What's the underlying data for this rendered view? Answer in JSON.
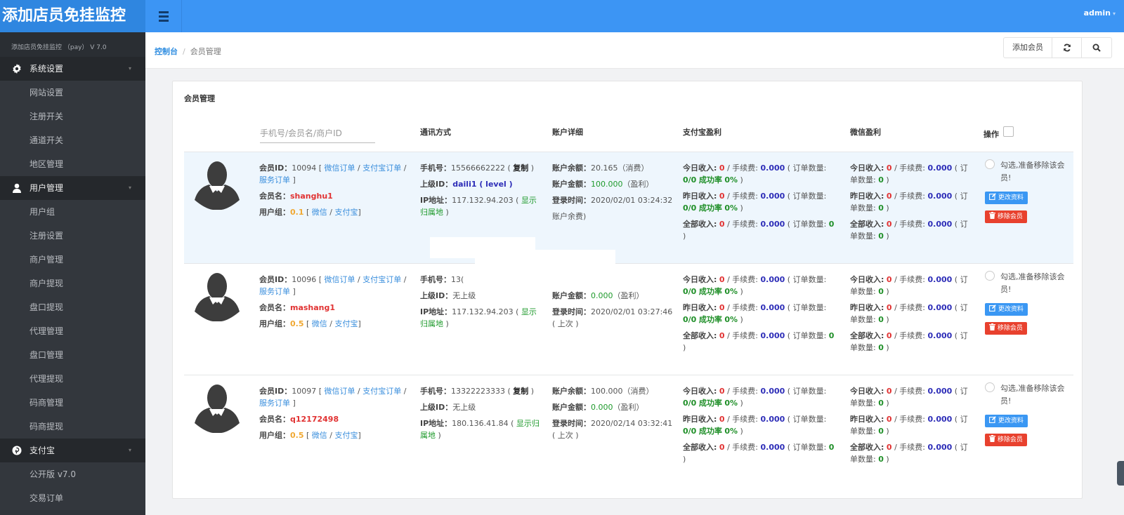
{
  "header": {
    "brand": "添加店员免挂监控",
    "menu_icon": "hamburger-icon",
    "user": "admin",
    "user_caret": "▾"
  },
  "sidebar": {
    "version": "添加店员免挂监控 （pay） V 7.0",
    "groups": [
      {
        "label": "系统设置",
        "icon": "gear-icon",
        "items": [
          "网站设置",
          "注册开关",
          "通道开关",
          "地区管理"
        ]
      },
      {
        "label": "用户管理",
        "icon": "user-icon",
        "items": [
          "用户组",
          "注册设置",
          "商户管理",
          "商户提现",
          "盘口提现",
          "代理管理",
          "盘口管理",
          "代理提现",
          "码商管理",
          "码商提现"
        ]
      },
      {
        "label": "支付宝",
        "icon": "pinterest-icon",
        "items": [
          "公开版 v7.0",
          "交易订单"
        ]
      }
    ],
    "arrow": "▾"
  },
  "breadcrumb": {
    "home": "控制台",
    "separator": "/",
    "current": "会员管理"
  },
  "toolbar": {
    "add_member": "添加会员",
    "refresh_icon": "⟳",
    "search_icon": "🔍"
  },
  "panel": {
    "title": "会员管理",
    "search_placeholder": "手机号/会员名/商户ID",
    "columns": {
      "contact": "通讯方式",
      "account": "账户详细",
      "alipay": "支付宝盈利",
      "wechat": "微信盈利",
      "ops": "操作"
    }
  },
  "labels": {
    "member_id": "会员ID：",
    "wechat_order": "微信订单",
    "alipay_order": "支付宝订单",
    "service_order": "服务订单",
    "member_name": "会员名：",
    "user_group": "用户组：",
    "wechat": "微信",
    "alipay": "支付宝",
    "phone": "手机号：",
    "copy": "复制",
    "parent_id": "上级ID：",
    "ip": "IP地址：",
    "show_location": "显示归属地",
    "balance": "账户余额：",
    "balance_note": "（消费）",
    "amount": "账户金额：",
    "amount_note": "（盈利）",
    "login_time": "登录时间：",
    "last": "( 上次 )",
    "today_income": "今日收入:",
    "yesterday_income": "昨日收入:",
    "all_income": "全部收入:",
    "fee": "/ 手续费:",
    "order_count": "( 订单数量:",
    "success_rate": "成功率",
    "remove_check": "勾选,准备移除该会员!",
    "edit_btn": "更改资料",
    "delete_btn": "移除会员"
  },
  "members": [
    {
      "id": "10094",
      "name": "shanghu1",
      "group_rate": "0.1",
      "phone": "15566662222",
      "phone_copy": true,
      "parent": "daili1 ( level )",
      "ip": "117.132.94.203",
      "balance": "20.165",
      "amount": "100.000",
      "login_time": "2020/02/01 03:24:32",
      "extra_line": "账户余费)",
      "alipay": {
        "today": {
          "income": "0",
          "fee": "0.000",
          "orders": "0/0",
          "rate": "0%"
        },
        "yesterday": {
          "income": "0",
          "fee": "0.000",
          "orders": "0/0",
          "rate": "0%"
        },
        "all": {
          "income": "0",
          "fee": "0.000",
          "orders": "0"
        }
      },
      "wechat": {
        "today": {
          "income": "0",
          "fee": "0.000",
          "orders": "0"
        },
        "yesterday": {
          "income": "0",
          "fee": "0.000",
          "orders": "0"
        },
        "all": {
          "income": "0",
          "fee": "0.000",
          "orders": "0"
        }
      }
    },
    {
      "id": "10096",
      "name": "mashang1",
      "group_rate": "0.5",
      "phone": "13(",
      "phone_copy": false,
      "parent": "无上级",
      "ip": "117.132.94.203",
      "balance": "",
      "amount": "0.000",
      "login_time": "2020/02/01 03:27:46",
      "alipay": {
        "today": {
          "income": "0",
          "fee": "0.000",
          "orders": "0/0",
          "rate": "0%"
        },
        "yesterday": {
          "income": "0",
          "fee": "0.000",
          "orders": "0/0",
          "rate": "0%"
        },
        "all": {
          "income": "0",
          "fee": "0.000",
          "orders": "0"
        }
      },
      "wechat": {
        "today": {
          "income": "0",
          "fee": "0.000",
          "orders": "0"
        },
        "yesterday": {
          "income": "0",
          "fee": "0.000",
          "orders": "0"
        },
        "all": {
          "income": "0",
          "fee": "0.000",
          "orders": "0"
        }
      }
    },
    {
      "id": "10097",
      "name": "q12172498",
      "group_rate": "0.5",
      "phone": "13322223333",
      "phone_copy": true,
      "parent": "无上级",
      "ip": "180.136.41.84",
      "balance": "100.000",
      "amount": "0.000",
      "login_time": "2020/02/14 03:32:41",
      "alipay": {
        "today": {
          "income": "0",
          "fee": "0.000",
          "orders": "0/0",
          "rate": "0%"
        },
        "yesterday": {
          "income": "0",
          "fee": "0.000",
          "orders": "0/0",
          "rate": "0%"
        },
        "all": {
          "income": "0",
          "fee": "0.000",
          "orders": "0"
        }
      },
      "wechat": {
        "today": {
          "income": "0",
          "fee": "0.000",
          "orders": "0"
        },
        "yesterday": {
          "income": "0",
          "fee": "0.000",
          "orders": "0"
        },
        "all": {
          "income": "0",
          "fee": "0.000",
          "orders": "0"
        }
      }
    }
  ]
}
